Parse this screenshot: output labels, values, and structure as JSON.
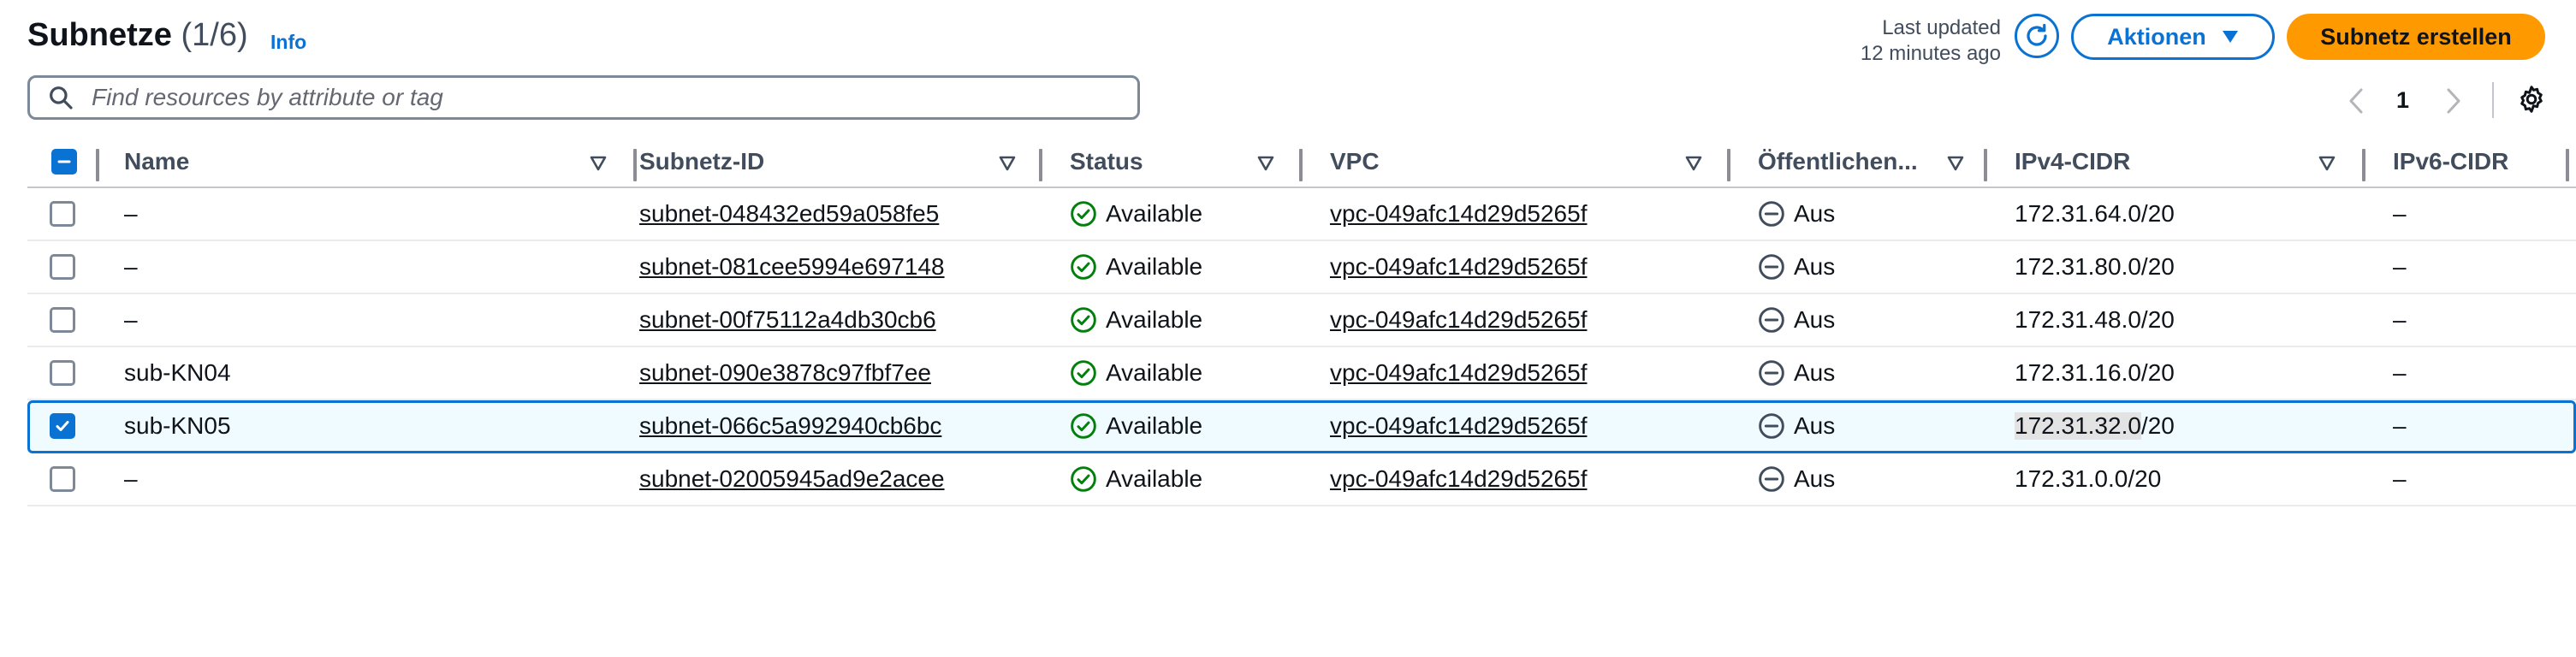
{
  "header": {
    "title": "Subnetze",
    "count": "(1/6)",
    "info": "Info",
    "last_updated_line1": "Last updated",
    "last_updated_line2": "12 minutes ago",
    "actions_label": "Aktionen",
    "create_label": "Subnetz erstellen"
  },
  "search": {
    "placeholder": "Find resources by attribute or tag",
    "value": ""
  },
  "pagination": {
    "current_page": "1"
  },
  "columns": {
    "name": "Name",
    "subnet_id": "Subnetz-ID",
    "status": "Status",
    "vpc": "VPC",
    "public": "Öffentlichen...",
    "ipv4": "IPv4-CIDR",
    "ipv6": "IPv6-CIDR"
  },
  "rows": [
    {
      "selected": false,
      "name": "–",
      "subnet_id": "subnet-048432ed59a058fe5",
      "status": "Available",
      "vpc": "vpc-049afc14d29d5265f",
      "public": "Aus",
      "ipv4": "172.31.64.0/20",
      "ipv6": "–"
    },
    {
      "selected": false,
      "name": "–",
      "subnet_id": "subnet-081cee5994e697148",
      "status": "Available",
      "vpc": "vpc-049afc14d29d5265f",
      "public": "Aus",
      "ipv4": "172.31.80.0/20",
      "ipv6": "–"
    },
    {
      "selected": false,
      "name": "–",
      "subnet_id": "subnet-00f75112a4db30cb6",
      "status": "Available",
      "vpc": "vpc-049afc14d29d5265f",
      "public": "Aus",
      "ipv4": "172.31.48.0/20",
      "ipv6": "–"
    },
    {
      "selected": false,
      "name": "sub-KN04",
      "subnet_id": "subnet-090e3878c97fbf7ee",
      "status": "Available",
      "vpc": "vpc-049afc14d29d5265f",
      "public": "Aus",
      "ipv4": "172.31.16.0/20",
      "ipv6": "–"
    },
    {
      "selected": true,
      "name": "sub-KN05",
      "subnet_id": "subnet-066c5a992940cb6bc",
      "status": "Available",
      "vpc": "vpc-049afc14d29d5265f",
      "public": "Aus",
      "ipv4_highlight": "172.31.32.0",
      "ipv4_rest": "/20",
      "ipv6": "–"
    },
    {
      "selected": false,
      "name": "–",
      "subnet_id": "subnet-02005945ad9e2acee",
      "status": "Available",
      "vpc": "vpc-049afc14d29d5265f",
      "public": "Aus",
      "ipv4": "172.31.0.0/20",
      "ipv6": "–"
    }
  ],
  "colors": {
    "accent": "#0972d3",
    "primary_button": "#ff9900",
    "success": "#037f0c"
  },
  "icons": [
    "search-icon",
    "refresh-icon",
    "caret-down-icon",
    "chevron-left-icon",
    "chevron-right-icon",
    "settings-icon",
    "sort-icon",
    "status-available-icon",
    "status-stopped-icon"
  ]
}
